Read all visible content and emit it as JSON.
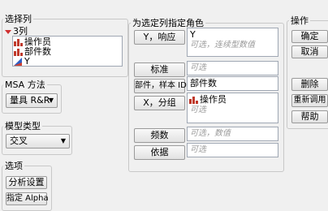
{
  "select_columns": {
    "title": "选择列",
    "group_label": "3列",
    "columns": [
      {
        "name": "操作员",
        "icon": "nominal-bar-icon"
      },
      {
        "name": "部件数",
        "icon": "nominal-bar-icon"
      },
      {
        "name": "Y",
        "icon": "continuous-triangle-icon"
      }
    ]
  },
  "msa": {
    "title": "MSA 方法",
    "value": "量具 R&R"
  },
  "model": {
    "title": "模型类型",
    "value": "交叉"
  },
  "options": {
    "title": "选项",
    "buttons": [
      "分析设置",
      "指定 Alpha"
    ]
  },
  "roles": {
    "title": "为选定列指定角色",
    "y": {
      "button": "Y，响应",
      "value": "Y",
      "hint": "可选，连续型数值"
    },
    "std": {
      "button": "标准",
      "hint": "可选"
    },
    "part": {
      "button": "部件，样本 ID",
      "value": "部件数"
    },
    "xgroup": {
      "button": "X，分组",
      "value": "操作员",
      "hint": "可选"
    },
    "freq": {
      "button": "频数",
      "hint": "可选，数值"
    },
    "by": {
      "button": "依据",
      "hint": "可选"
    }
  },
  "actions": {
    "title": "操作",
    "ok": "确定",
    "cancel": "取消",
    "remove": "删除",
    "recall": "重新调用",
    "help": "帮助"
  },
  "colors": {
    "nominal": "#c0392b",
    "continuous_blue": "#2f5fc4",
    "continuous_red": "#d04030",
    "disclosure": "#d03030"
  }
}
